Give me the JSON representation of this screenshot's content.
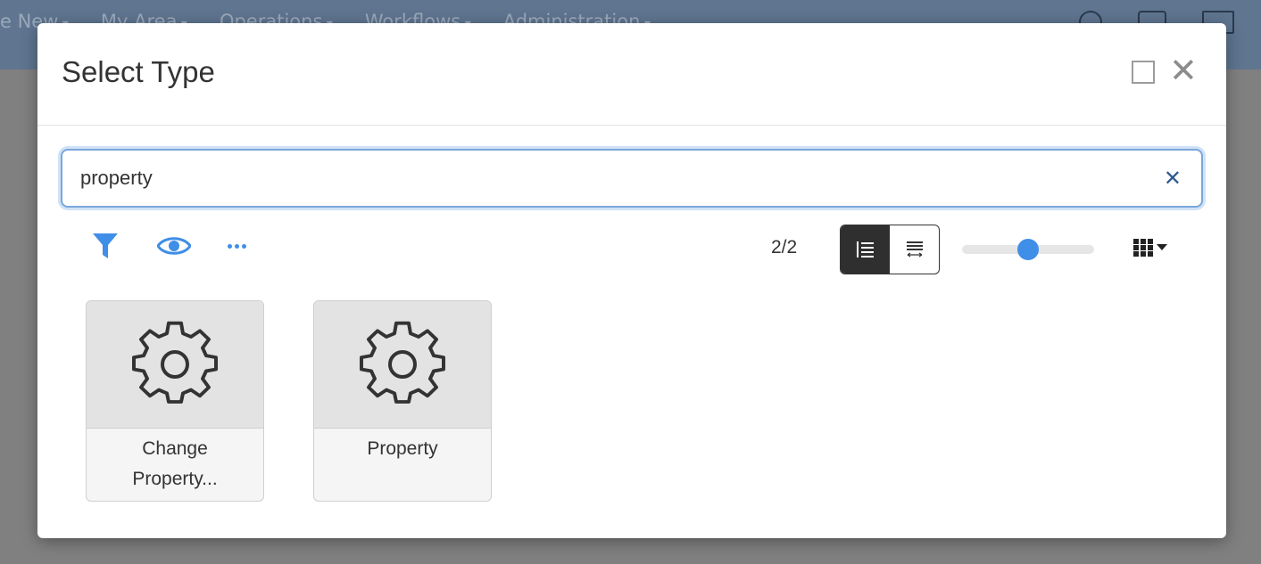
{
  "background": {
    "nav_items": [
      "e New",
      "My Area",
      "Operations",
      "Workflows",
      "Administration"
    ]
  },
  "dialog": {
    "title": "Select Type",
    "maximize_icon": "square-icon",
    "close_label": "✕"
  },
  "search": {
    "value": "property",
    "clear_label": "✕"
  },
  "toolbar": {
    "filter_icon": "filter-icon",
    "eye_icon": "eye-icon",
    "more_icon": "ellipsis-icon",
    "count": "2/2",
    "view_modes": [
      "list-view",
      "detail-view"
    ],
    "active_view": "list-view",
    "size_slider_level": 0.5,
    "grid_icon": "grid-icon"
  },
  "results": [
    {
      "label": "Change Property...",
      "label_lines": [
        "Change",
        "Property..."
      ],
      "icon": "gear-icon"
    },
    {
      "label": "Property",
      "label_lines": [
        "Property"
      ],
      "icon": "gear-icon"
    }
  ],
  "colors": {
    "accent": "#3f8ee8",
    "title": "#333333",
    "overlay": "#808080"
  }
}
